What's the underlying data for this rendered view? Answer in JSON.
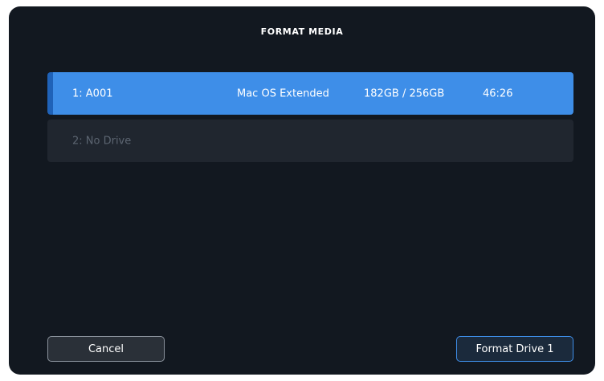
{
  "dialog": {
    "title": "FORMAT MEDIA"
  },
  "drives": [
    {
      "name": "1: A001",
      "format": "Mac OS Extended",
      "capacity": "182GB / 256GB",
      "time_remaining": "46:26",
      "selected": true
    },
    {
      "name": "2: No Drive",
      "selected": false
    }
  ],
  "buttons": {
    "cancel_label": "Cancel",
    "format_label": "Format Drive 1"
  },
  "colors": {
    "background": "#121820",
    "selected_row": "#3e8ee8",
    "empty_row": "#20262f",
    "accent": "#3e8ee8"
  }
}
